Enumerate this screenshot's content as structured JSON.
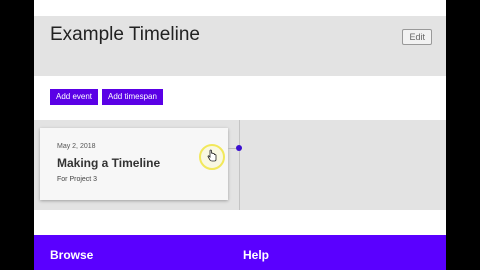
{
  "header": {
    "title": "Example Timeline",
    "edit_label": "Edit"
  },
  "toolbar": {
    "add_event_label": "Add event",
    "add_timespan_label": "Add timespan"
  },
  "event": {
    "date": "May 2, 2018",
    "title": "Making a Timeline",
    "subtitle": "For Project 3"
  },
  "footer": {
    "browse_label": "Browse",
    "help_label": "Help"
  },
  "colors": {
    "accent": "#5a00e6",
    "footer": "#5a00ff",
    "marker": "#3a0ecf"
  },
  "icons": {
    "cursor": "hand-pointer-icon"
  }
}
